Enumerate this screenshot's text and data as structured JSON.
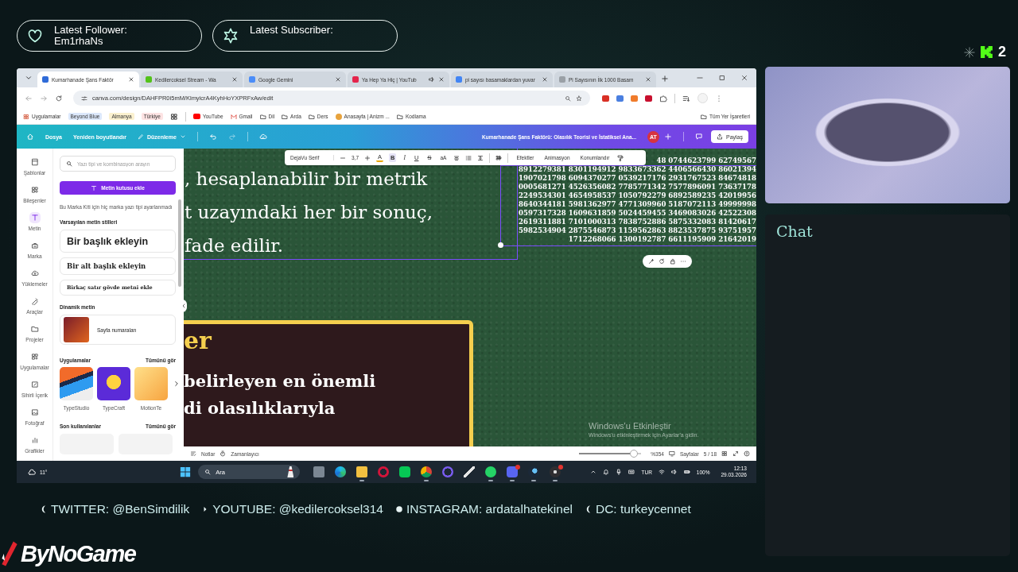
{
  "alerts": [
    {
      "kind": "follower",
      "label": "Latest Follower:",
      "value": "Em1rhaNs"
    },
    {
      "kind": "subscriber",
      "label": "Latest Subscriber:"
    }
  ],
  "viewer_badge": {
    "count": "2"
  },
  "browser": {
    "tabs": [
      {
        "kind": "canva",
        "title": "Kumarhanade Şans Faktör",
        "selected": true,
        "audio": false
      },
      {
        "kind": "kick",
        "title": "Kedilercoksel Stream - Wa",
        "selected": false,
        "audio": false
      },
      {
        "kind": "gemini",
        "title": "Google Gemini",
        "selected": false,
        "audio": false
      },
      {
        "kind": "music",
        "title": "Ya Hep Ya Hiç | YouTub",
        "selected": false,
        "audio": true
      },
      {
        "kind": "google",
        "title": "pi sayısı basamaklardan yuvar",
        "selected": false,
        "audio": false
      },
      {
        "kind": "page",
        "title": "Pi Sayısının İlk 1000 Basam",
        "selected": false,
        "audio": false
      }
    ],
    "address": "canva.com/design/DAHFPR0i5mM/KlmyicrA4KyhHoYXPRFxAw/edit",
    "extensions": [
      {
        "color": "#d93025"
      },
      {
        "color": "#4a7fe0"
      },
      {
        "color": "#f07b2b"
      },
      {
        "color": "#c8102e"
      }
    ],
    "bookmarks": [
      {
        "kind": "apps",
        "label": "Uygulamalar"
      },
      {
        "kind": "chip",
        "label": "Beyond Blue",
        "color": "#dce8fb"
      },
      {
        "kind": "chip",
        "label": "Almanya",
        "color": "#fbf1cf"
      },
      {
        "kind": "chip",
        "label": "Türkiye",
        "color": "#fde3e3"
      },
      {
        "kind": "grid"
      },
      {
        "kind": "youtube",
        "label": "YouTube"
      },
      {
        "kind": "gmail",
        "label": "Gmail"
      },
      {
        "kind": "folder",
        "label": "Dil"
      },
      {
        "kind": "folder",
        "label": "Arda"
      },
      {
        "kind": "folder",
        "label": "Ders"
      },
      {
        "kind": "site",
        "label": "Anasayfa | Anizm ..."
      },
      {
        "kind": "folder",
        "label": "Kodlama"
      }
    ],
    "all_bookmarks": "Tüm Yer İşaretleri"
  },
  "canva": {
    "menu": [
      "Dosya",
      "Yeniden boyutlandır"
    ],
    "edit_menu": "Düzenleme",
    "document_title": "Kumarhanade Şans Faktörü: Olasılık Teorisi ve İstatiksel Ana...",
    "avatar": "AT",
    "share": "Paylaş",
    "rail": [
      {
        "kind": "templates",
        "label": "Şablonlar",
        "selected": false
      },
      {
        "kind": "elements",
        "label": "Bileşenler",
        "selected": false
      },
      {
        "kind": "text",
        "label": "Metin",
        "selected": true
      },
      {
        "kind": "brand",
        "label": "Marka",
        "selected": false
      },
      {
        "kind": "uploads",
        "label": "Yüklemeler",
        "selected": false
      },
      {
        "kind": "tools",
        "label": "Araçlar",
        "selected": false
      },
      {
        "kind": "projects",
        "label": "Projeler",
        "selected": false
      },
      {
        "kind": "apps",
        "label": "Uygulamalar",
        "selected": false
      },
      {
        "kind": "magic",
        "label": "Sihirli İçerik",
        "selected": false
      },
      {
        "kind": "photos",
        "label": "Fotoğraf",
        "selected": false
      },
      {
        "kind": "charts",
        "label": "Grafikler",
        "selected": false
      }
    ],
    "panel": {
      "search_placeholder": "Yazı tipi ve kombinasyon arayın",
      "add_button": "Metin kutusu ekle",
      "note": "Bu Marka Kiti için hiç marka yazı tipi ayarlanmadı",
      "defaults_heading": "Varsayılan metin stilleri",
      "styles": [
        {
          "kind": "heading",
          "label": "Bir başlık ekleyin"
        },
        {
          "kind": "subheading",
          "label": "Bir alt başlık ekleyin"
        },
        {
          "kind": "body",
          "label": "Birkaç satır gövde metni ekle"
        }
      ],
      "dynamic_heading": "Dinamik metin",
      "dynamic_item": "Sayfa numaraları",
      "apps_heading": "Uygulamalar",
      "apps_link": "Tümünü gör",
      "apps": [
        {
          "kind": "typestudio",
          "label": "TypeStudio"
        },
        {
          "kind": "typecraft",
          "label": "TypeCraft"
        },
        {
          "kind": "motion",
          "label": "MotionTe"
        }
      ],
      "recent_heading": "Son kullanılanlar",
      "recent_link": "Tümünü gör"
    },
    "toolbar": {
      "font": "DejaVu Serif",
      "size": "3,7",
      "format": [
        {
          "kind": "color",
          "label": "A",
          "selected": false
        },
        {
          "kind": "bold",
          "label": "B",
          "selected": true
        },
        {
          "kind": "italic",
          "label": "I",
          "selected": false
        },
        {
          "kind": "underline",
          "label": "U",
          "selected": false
        },
        {
          "kind": "strike",
          "label": "S",
          "selected": false
        },
        {
          "kind": "case",
          "label": "aA",
          "selected": false
        }
      ],
      "actions": [
        "Efektler",
        "Animasyon",
        "Konumlandır"
      ]
    },
    "canvas": {
      "text_lines": [
        ", hesaplanabilir bir metrik",
        "t uzayındaki her bir sonuç,",
        "fade edilir."
      ],
      "digits": [
        "48 0744623799 62749567",
        "8912279381 8301194912 9833673362 4406566430 86021394",
        "1907021798 6094370277 0539217176 2931767523 84674818",
        "0005681271 4526356082 7785771342 7577896091 73637178",
        "2249534301 4654958537 1050792279 6892589235 42019956",
        "8640344181 5981362977 4771309960 5187072113 49999998",
        "0597317328 1609631859 5024459455 3469083026 42522308",
        "2619311881 7101000313 7838752886 5875332083 81420617",
        "5982534904 2875546873 1159562863 8823537875 93751957",
        "1712268066 1300192787 6611195909 21642019"
      ],
      "box": {
        "heading": "er",
        "lines": [
          "belirleyen en önemli",
          "di olasılıklarıyla"
        ]
      }
    },
    "status": {
      "notes": "Notlar",
      "timer": "Zamanlayıcı",
      "zoom": {
        "level": 0.88
      },
      "zoom_reading": "%354",
      "pages": "Sayfalar",
      "page_count": "5 / 18"
    },
    "watermark": {
      "title": "Windows'u Etkinleştir",
      "hint": "Windows'u etkinleştirmek için Ayarlar'a gidin."
    }
  },
  "taskbar": {
    "weather": "11°",
    "search": "Ara",
    "apps": [
      {
        "kind": "taskview",
        "active": false,
        "notification": false
      },
      {
        "kind": "edge",
        "active": false,
        "notification": false
      },
      {
        "kind": "explorer",
        "active": true,
        "notification": false
      },
      {
        "kind": "opera",
        "active": false,
        "notification": false
      },
      {
        "kind": "line",
        "active": false,
        "notification": false
      },
      {
        "kind": "chrome",
        "active": true,
        "notification": false
      },
      {
        "kind": "ring",
        "active": false,
        "notification": false
      },
      {
        "kind": "pen",
        "active": false,
        "notification": false
      },
      {
        "kind": "whatsapp",
        "active": true,
        "notification": false
      },
      {
        "kind": "discord",
        "active": true,
        "notification": true
      },
      {
        "kind": "steam",
        "active": true,
        "notification": false
      },
      {
        "kind": "obs",
        "active": true,
        "notification": true
      }
    ],
    "language": "TUR",
    "battery": "100%",
    "time": "12:13",
    "date": "29.03.2026"
  },
  "chat": {
    "title": "Chat"
  },
  "socials": [
    {
      "kind": "twitter",
      "text": "TWITTER: @BenSimdilik"
    },
    {
      "kind": "youtube",
      "text": "YOUTUBE: @kedilercoksel314"
    },
    {
      "kind": "instagram",
      "text": "INSTAGRAM: ardatalhatekinel"
    },
    {
      "kind": "discord",
      "text": "DC: turkeycennet"
    }
  ],
  "brand": "ByNoGame"
}
